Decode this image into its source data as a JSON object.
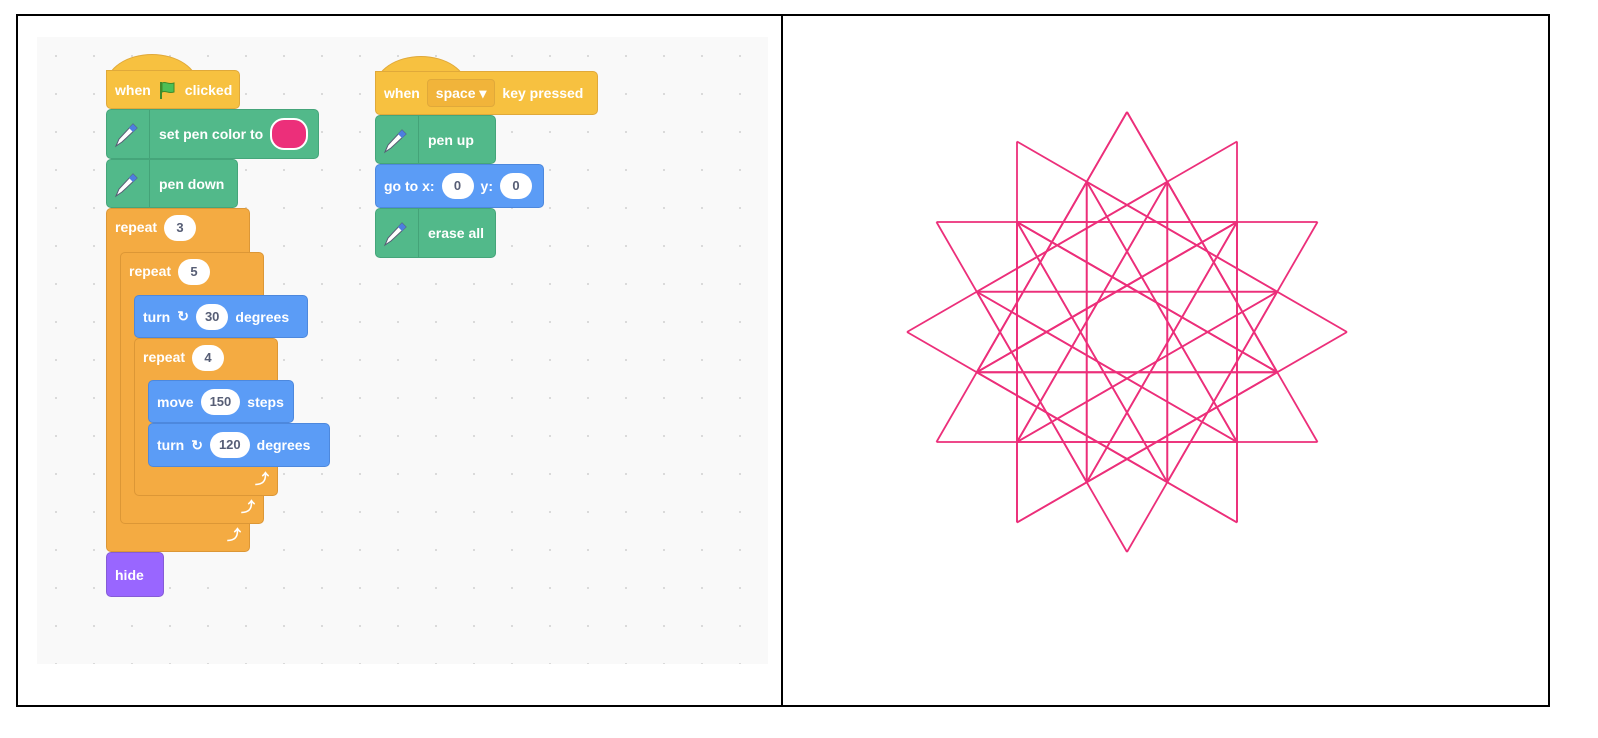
{
  "colors": {
    "events": "#f7c140",
    "pen": "#52b98a",
    "motion": "#5b9cf6",
    "control": "#f4ab42",
    "looks": "#9966ff",
    "pen_color": "#ec2f7a"
  },
  "script1": {
    "hat": {
      "when": "when",
      "icon": "green-flag-icon",
      "clicked": "clicked"
    },
    "set_pen_color": {
      "label": "set pen color to",
      "value": "#ec2f7a"
    },
    "pen_down": {
      "label": "pen down"
    },
    "repeat_outer": {
      "label": "repeat",
      "value": "3"
    },
    "repeat_mid": {
      "label": "repeat",
      "value": "5"
    },
    "turn1": {
      "label": "turn",
      "value": "30",
      "unit": "degrees"
    },
    "repeat_inner": {
      "label": "repeat",
      "value": "4"
    },
    "move": {
      "label": "move",
      "value": "150",
      "unit": "steps"
    },
    "turn2": {
      "label": "turn",
      "value": "120",
      "unit": "degrees"
    },
    "hide": {
      "label": "hide"
    }
  },
  "script2": {
    "hat": {
      "when": "when",
      "key": "space",
      "pressed": "key pressed"
    },
    "pen_up": {
      "label": "pen up"
    },
    "goto": {
      "label": "go to x:",
      "x": "0",
      "ylabel": "y:",
      "y": "0"
    },
    "erase": {
      "label": "erase all"
    }
  },
  "stage": {
    "pen_color": "#ec2f7a",
    "program": {
      "outer": 3,
      "mid": 5,
      "turn": 30,
      "inner": 4,
      "steps": 150,
      "turn2": 120
    }
  }
}
